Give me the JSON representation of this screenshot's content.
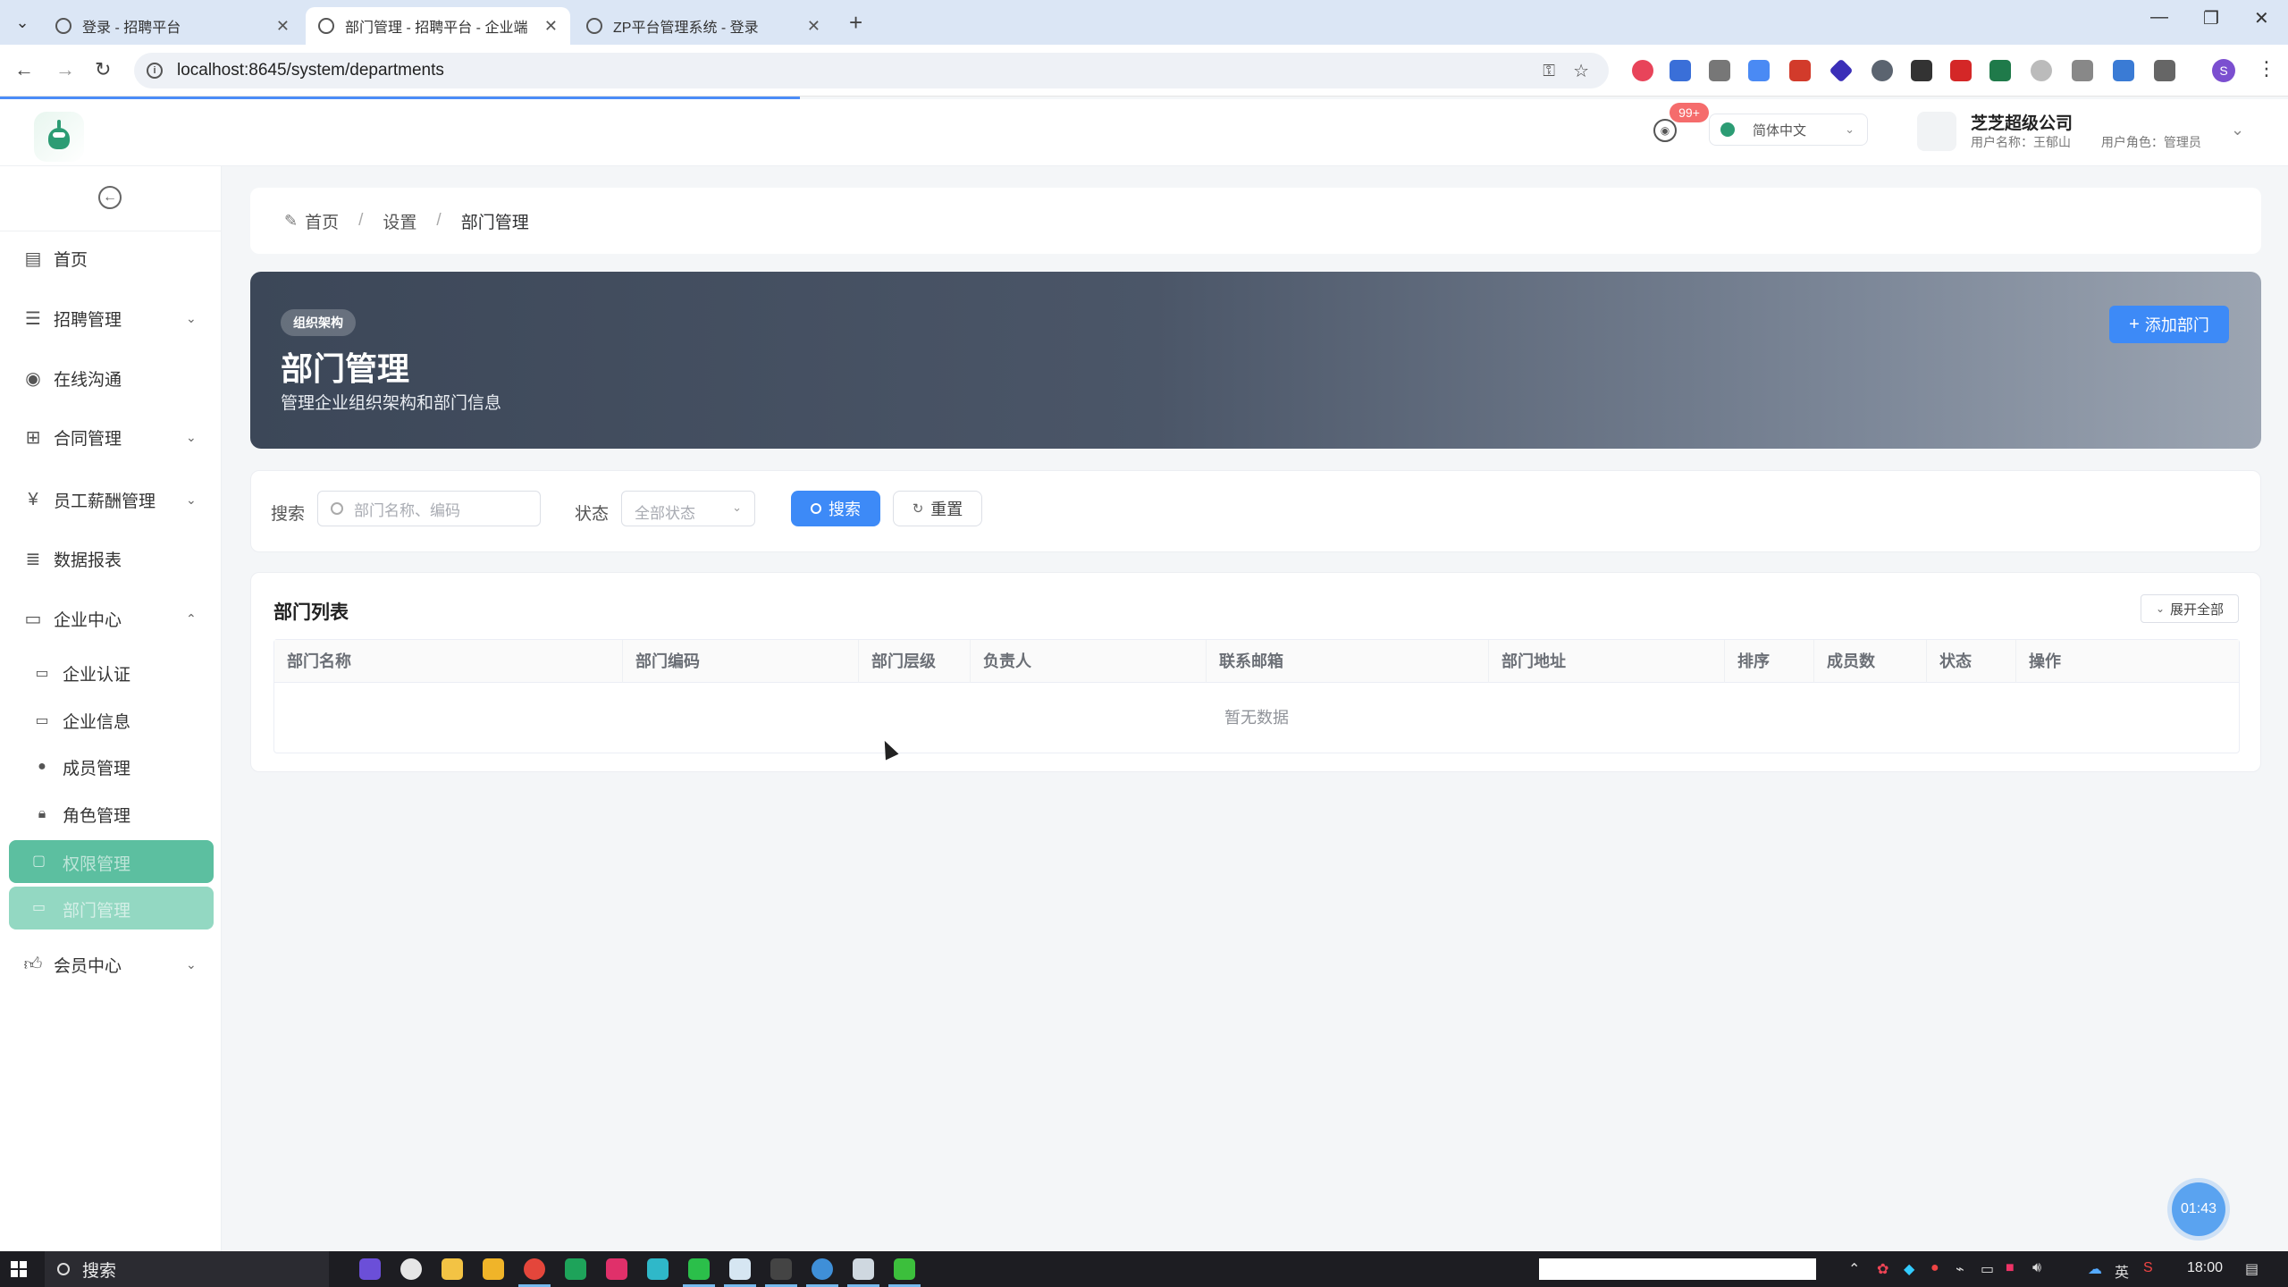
{
  "browser": {
    "tabs": [
      {
        "title": "登录 - 招聘平台",
        "active": false
      },
      {
        "title": "部门管理 - 招聘平台 - 企业端",
        "active": true
      },
      {
        "title": "ZP平台管理系统 - 登录",
        "active": false
      }
    ],
    "url": "localhost:8645/system/departments",
    "profile_initial": "S"
  },
  "header": {
    "notification_badge": "99+",
    "language": "简体中文",
    "company_name": "芝芝超级公司",
    "user_name_label": "用户名称：王郁山",
    "user_role_label": "用户角色：管理员"
  },
  "sidebar": {
    "items": [
      {
        "label": "首页",
        "icon": "document-icon"
      },
      {
        "label": "招聘管理",
        "icon": "list-icon"
      },
      {
        "label": "在线沟通",
        "icon": "chat-icon"
      },
      {
        "label": "合同管理",
        "icon": "grid-icon"
      },
      {
        "label": "员工薪酬管理",
        "icon": "yen-icon"
      },
      {
        "label": "数据报表",
        "icon": "report-icon"
      },
      {
        "label": "企业中心",
        "icon": "card-icon"
      },
      {
        "label": "会员中心",
        "icon": "thumb-icon"
      }
    ],
    "sub_items": [
      {
        "label": "企业认证"
      },
      {
        "label": "企业信息"
      },
      {
        "label": "成员管理"
      },
      {
        "label": "角色管理"
      },
      {
        "label": "权限管理"
      },
      {
        "label": "部门管理"
      }
    ]
  },
  "breadcrumb": {
    "items": [
      "首页",
      "设置",
      "部门管理"
    ]
  },
  "hero": {
    "tag": "组织架构",
    "title": "部门管理",
    "subtitle": "管理企业组织架构和部门信息",
    "add_button": "添加部门"
  },
  "search": {
    "keyword_label": "搜索",
    "keyword_placeholder": "部门名称、编码",
    "status_label": "状态",
    "status_placeholder": "全部状态",
    "search_button": "搜索",
    "reset_button": "重置"
  },
  "list": {
    "title": "部门列表",
    "expand_button": "展开全部",
    "columns": [
      "部门名称",
      "部门编码",
      "部门层级",
      "负责人",
      "联系邮箱",
      "部门地址",
      "排序",
      "成员数",
      "状态",
      "操作"
    ],
    "empty_text": "暂无数据"
  },
  "timer": "01:43",
  "taskbar": {
    "search_text": "搜索",
    "input_method": "英",
    "clock": "18:00"
  },
  "colors": {
    "primary": "#3d8af7",
    "sidebar_active": "#5cbfa0",
    "hero_start": "#3c4758",
    "hero_end": "#9ca5b2"
  }
}
